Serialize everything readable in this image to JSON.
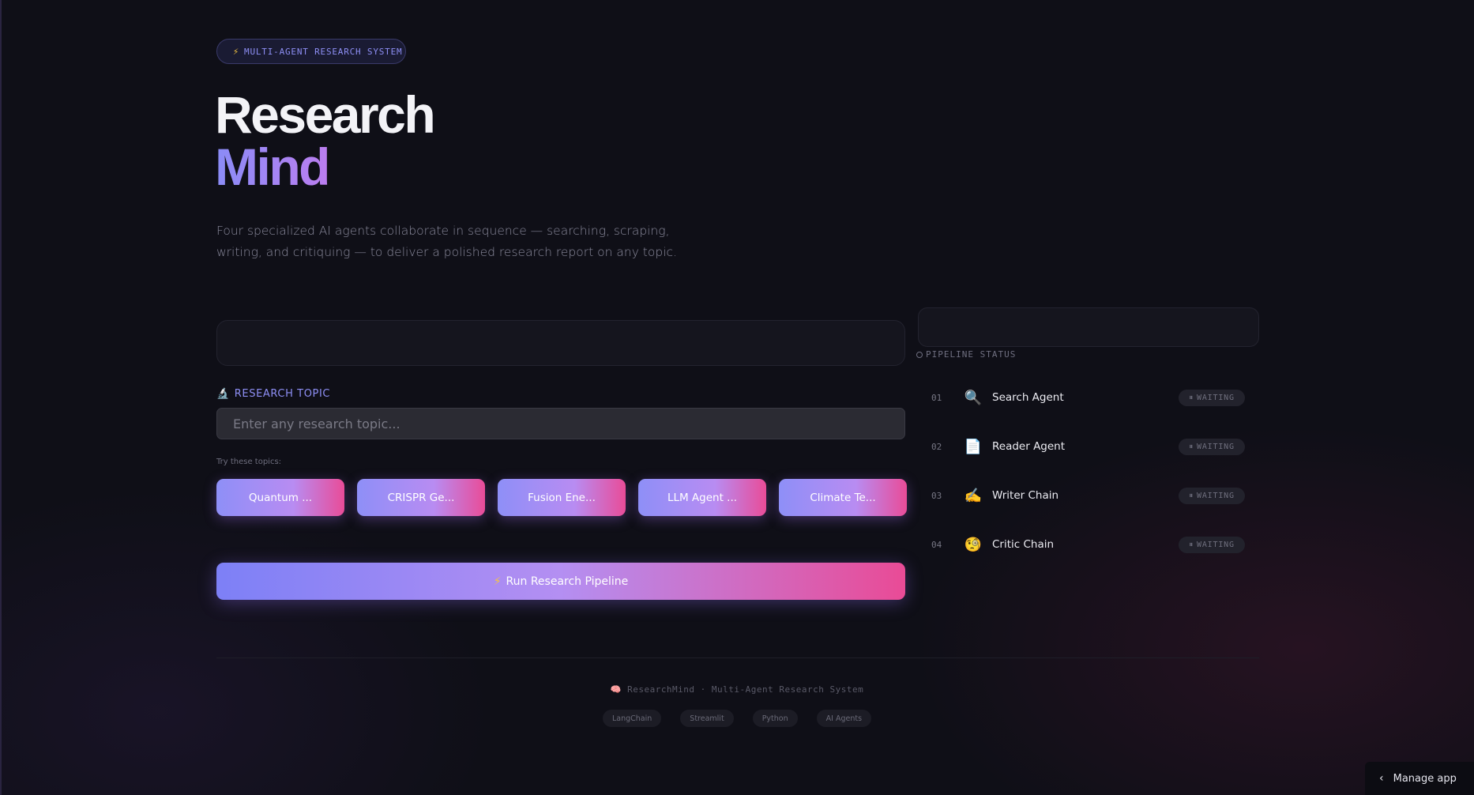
{
  "badge": {
    "icon": "⚡",
    "text": "MULTI-AGENT RESEARCH SYSTEM"
  },
  "title": {
    "line1": "Research",
    "line2": "Mind"
  },
  "description": "Four specialized AI agents collaborate in sequence — searching, scraping, writing, and critiquing — to deliver a polished research report on any topic.",
  "topic": {
    "icon": "🔬",
    "label": "RESEARCH TOPIC",
    "placeholder": "Enter any research topic...",
    "value": ""
  },
  "suggestions": {
    "label": "Try these topics:",
    "items": [
      "Quantum ...",
      "CRISPR Ge...",
      "Fusion Ene...",
      "LLM Agent ...",
      "Climate Te..."
    ]
  },
  "run_button": {
    "icon": "⚡",
    "label": "Run Research Pipeline"
  },
  "pipeline": {
    "label": "PIPELINE STATUS",
    "agents": [
      {
        "num": "01",
        "icon": "🔍",
        "name": "Search Agent",
        "status": "WAITING"
      },
      {
        "num": "02",
        "icon": "📄",
        "name": "Reader Agent",
        "status": "WAITING"
      },
      {
        "num": "03",
        "icon": "✍️",
        "name": "Writer Chain",
        "status": "WAITING"
      },
      {
        "num": "04",
        "icon": "🧐",
        "name": "Critic Chain",
        "status": "WAITING"
      }
    ]
  },
  "footer": {
    "icon": "🧠",
    "text": "ResearchMind · Multi-Agent Research System",
    "tags": [
      "LangChain",
      "Streamlit",
      "Python",
      "AI Agents"
    ]
  },
  "manage_app": {
    "label": "Manage app"
  }
}
